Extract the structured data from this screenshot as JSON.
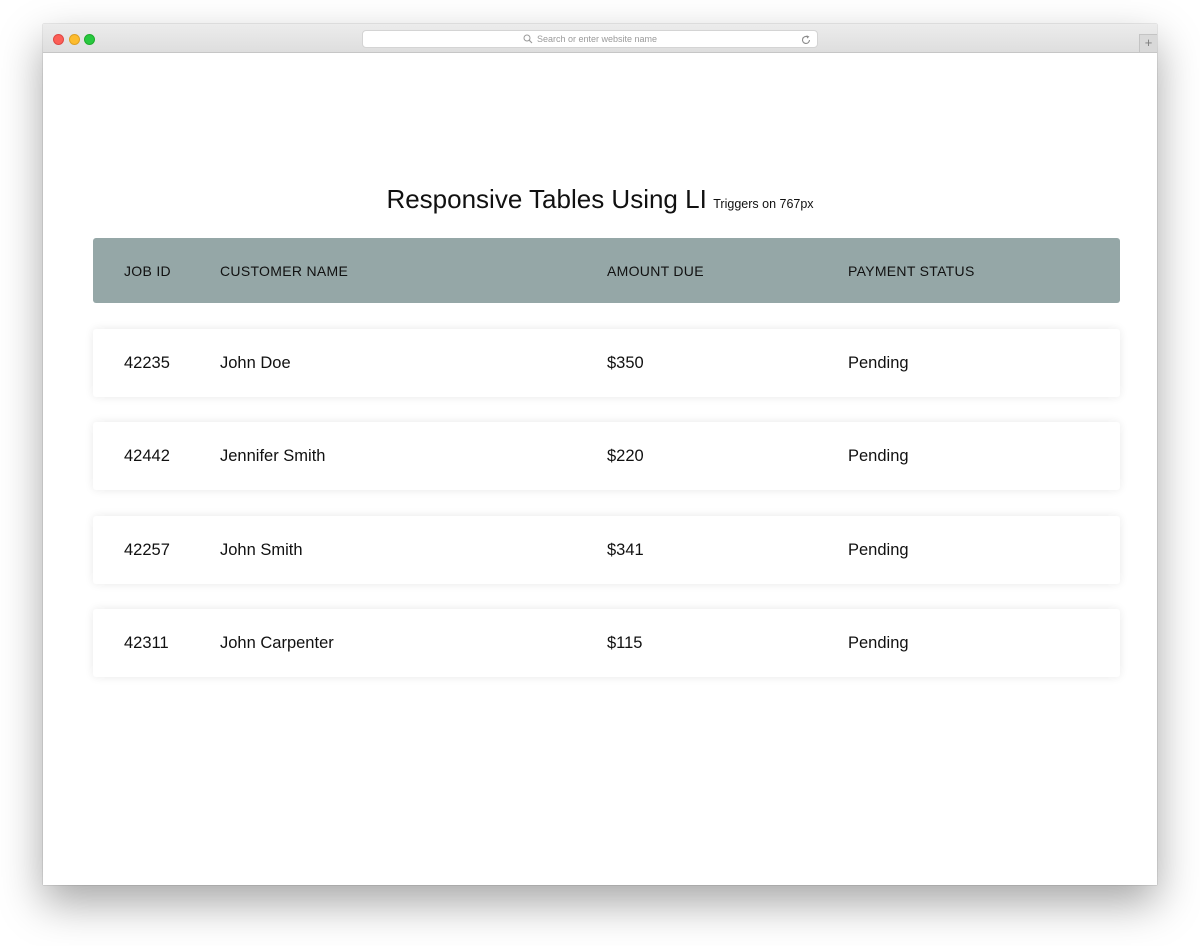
{
  "browser": {
    "url_placeholder": "Search or enter website name",
    "new_tab_symbol": "+",
    "icons": [
      "search-icon",
      "reload-icon"
    ]
  },
  "page": {
    "title": "Responsive Tables Using LI",
    "subtitle": "Triggers on 767px"
  },
  "table": {
    "header_bg": "#95a7a7",
    "columns": [
      "JOB ID",
      "CUSTOMER NAME",
      "AMOUNT DUE",
      "PAYMENT STATUS"
    ],
    "rows": [
      [
        "42235",
        "John Doe",
        "$350",
        "Pending"
      ],
      [
        "42442",
        "Jennifer Smith",
        "$220",
        "Pending"
      ],
      [
        "42257",
        "John Smith",
        "$341",
        "Pending"
      ],
      [
        "42311",
        "John Carpenter",
        "$115",
        "Pending"
      ]
    ]
  }
}
